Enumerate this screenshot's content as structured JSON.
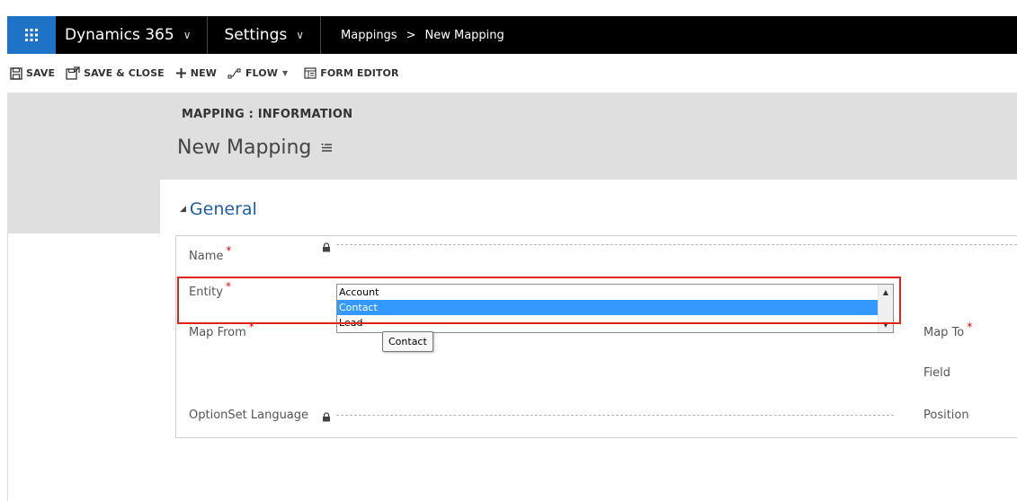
{
  "nav": {
    "app_name": "Dynamics 365",
    "area": "Settings",
    "breadcrumb": [
      "Mappings",
      "New Mapping"
    ],
    "breadcrumb_separator": ">",
    "accent_color": "#1f73c6"
  },
  "commands": {
    "save": "SAVE",
    "save_close": "SAVE & CLOSE",
    "new": "NEW",
    "flow": "FLOW",
    "form_editor": "FORM EDITOR"
  },
  "header": {
    "entity_label": "MAPPING : INFORMATION",
    "record_title": "New Mapping"
  },
  "section": {
    "title": "General"
  },
  "fields": {
    "name_label": "Name",
    "entity_label": "Entity",
    "map_from_label": "Map From",
    "optionset_language_label": "OptionSet Language",
    "map_to_label": "Map To",
    "field_label": "Field",
    "position_label": "Position",
    "required_marker": "*"
  },
  "entity_dropdown": {
    "options": [
      "Account",
      "Contact",
      "Lead"
    ],
    "selected": "Contact",
    "tooltip": "Contact"
  }
}
